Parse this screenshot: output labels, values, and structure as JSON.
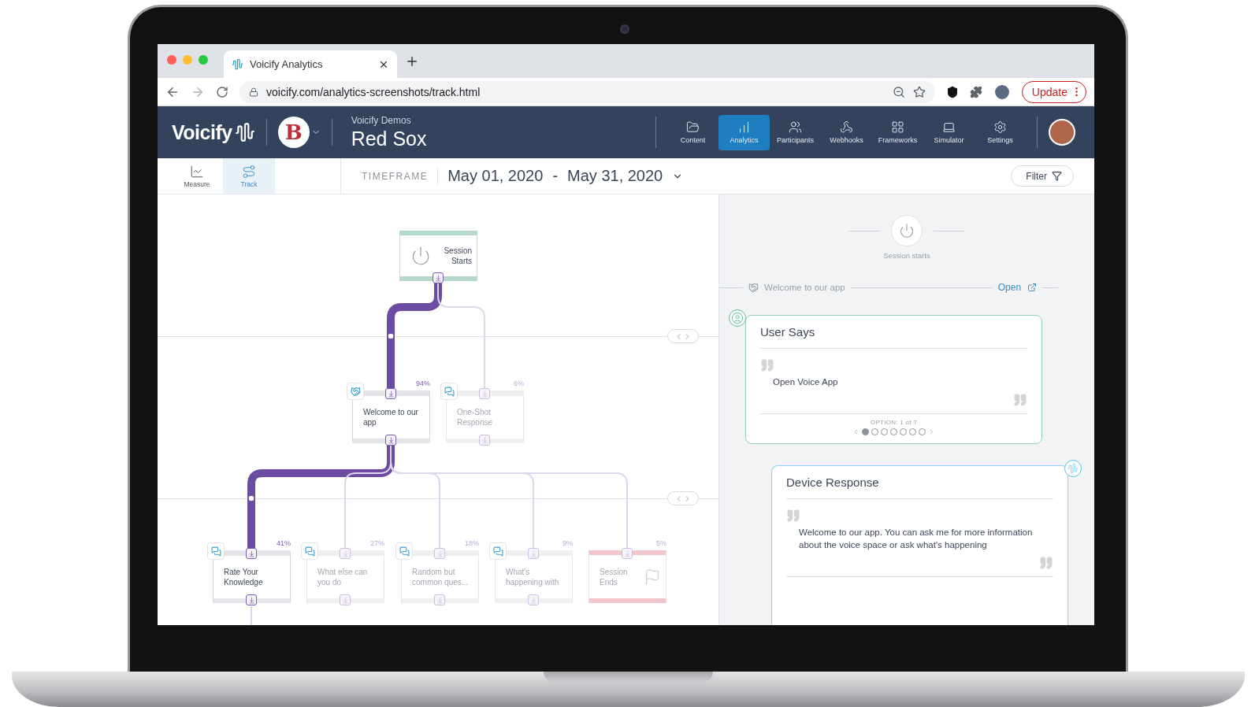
{
  "browser": {
    "tab_title": "Voicify Analytics",
    "url": "voicify.com/analytics-screenshots/track.html",
    "update_button": "Update"
  },
  "header": {
    "logo": "Voicify",
    "team_logo_letter": "B",
    "org": "Voicify Demos",
    "app_name": "Red Sox",
    "nav": [
      {
        "label": "Content",
        "selected": false
      },
      {
        "label": "Analytics",
        "selected": true
      },
      {
        "label": "Participants",
        "selected": false
      },
      {
        "label": "Webhooks",
        "selected": false
      },
      {
        "label": "Frameworks",
        "selected": false
      },
      {
        "label": "Simulator",
        "selected": false
      },
      {
        "label": "Settings",
        "selected": false
      }
    ]
  },
  "subnav": [
    {
      "label": "Measure",
      "selected": false
    },
    {
      "label": "Track",
      "selected": true
    }
  ],
  "timeframe": {
    "label": "TIMEFRAME",
    "start": "May 01, 2020",
    "separator": "-",
    "end": "May 31, 2020"
  },
  "filter_button": "Filter",
  "flow": {
    "nodes": [
      {
        "kind": "start",
        "title": "Session Starts",
        "highlighted": true
      },
      {
        "kind": "welcome",
        "title": "Welcome to our app",
        "percent": "94%",
        "highlighted": true
      },
      {
        "kind": "response",
        "title": "One-Shot Response",
        "percent": "6%",
        "highlighted": false
      },
      {
        "kind": "response",
        "title": "Rate Your Knowledge",
        "percent": "41%",
        "highlighted": true
      },
      {
        "kind": "response",
        "title": "What else can you do",
        "percent": "27%",
        "highlighted": false
      },
      {
        "kind": "response",
        "title": "Random but common ques...",
        "percent": "18%",
        "highlighted": false
      },
      {
        "kind": "response",
        "title": "What's happening with",
        "percent": "9%",
        "highlighted": false
      },
      {
        "kind": "end",
        "title": "Session Ends",
        "percent": "5%",
        "highlighted": false
      }
    ]
  },
  "detail": {
    "session_label": "Session starts",
    "step_title": "Welcome to our app",
    "open_link": "Open",
    "user_says": {
      "title": "User Says",
      "quote": "Open Voice App",
      "option_label": "OPTION: 1 of 7",
      "options": [
        {
          "selected": true
        },
        {
          "selected": false
        },
        {
          "selected": false
        },
        {
          "selected": false
        },
        {
          "selected": false
        },
        {
          "selected": false
        },
        {
          "selected": false
        }
      ]
    },
    "device_response": {
      "title": "Device Response",
      "quote": "Welcome to our app. You can ask me for more information about the voice space or ask what's happening"
    }
  }
}
